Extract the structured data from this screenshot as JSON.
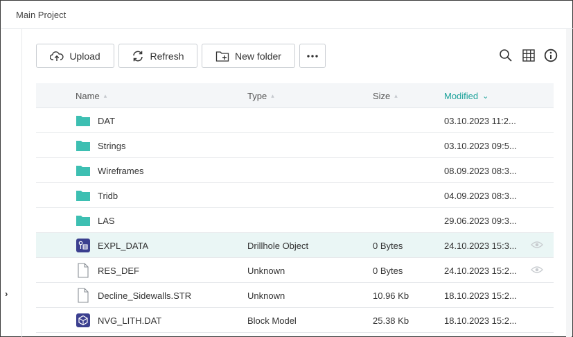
{
  "window": {
    "title": "Main Project"
  },
  "toolbar": {
    "upload_label": "Upload",
    "refresh_label": "Refresh",
    "new_folder_label": "New folder",
    "more_icon": "ellipsis-icon",
    "search_icon": "search-icon",
    "grid_icon": "grid-view-icon",
    "info_icon": "info-icon"
  },
  "table": {
    "columns": {
      "name": "Name",
      "type": "Type",
      "size": "Size",
      "modified": "Modified"
    },
    "sort": {
      "column": "modified",
      "direction": "descending"
    },
    "rows": [
      {
        "name": "DAT",
        "type": "",
        "size": "",
        "modified": "03.10.2023 11:2...",
        "icon": "folder"
      },
      {
        "name": "Strings",
        "type": "",
        "size": "",
        "modified": "03.10.2023 09:5...",
        "icon": "folder"
      },
      {
        "name": "Wireframes",
        "type": "",
        "size": "",
        "modified": "08.09.2023 08:3...",
        "icon": "folder"
      },
      {
        "name": "Tridb",
        "type": "",
        "size": "",
        "modified": "04.09.2023 08:3...",
        "icon": "folder"
      },
      {
        "name": "LAS",
        "type": "",
        "size": "",
        "modified": "29.06.2023 09:3...",
        "icon": "folder"
      },
      {
        "name": "EXPL_DATA",
        "type": "Drillhole Object",
        "size": "0 Bytes",
        "modified": "24.10.2023 15:3...",
        "icon": "drillhole",
        "selected": true,
        "preview": true
      },
      {
        "name": "RES_DEF",
        "type": "Unknown",
        "size": "0 Bytes",
        "modified": "24.10.2023 15:2...",
        "icon": "file",
        "preview": true
      },
      {
        "name": "Decline_Sidewalls.STR",
        "type": "Unknown",
        "size": "10.96 Kb",
        "modified": "18.10.2023 15:2...",
        "icon": "file"
      },
      {
        "name": "NVG_LITH.DAT",
        "type": "Block Model",
        "size": "25.38 Kb",
        "modified": "18.10.2023 15:2...",
        "icon": "block-model"
      }
    ]
  },
  "colors": {
    "accent": "#1ba29a",
    "folder": "#3dbfb2",
    "object_icon_bg": "#3b3f8f",
    "selected_row": "#eaf6f5"
  }
}
